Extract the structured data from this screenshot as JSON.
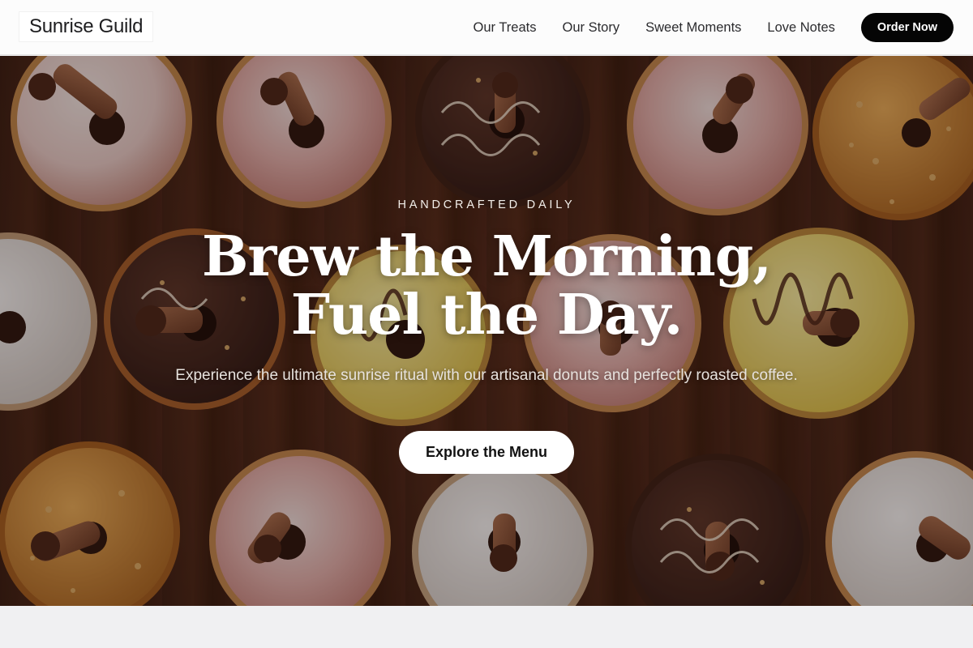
{
  "header": {
    "brand": "Sunrise Guild",
    "nav": [
      {
        "label": "Our Treats"
      },
      {
        "label": "Our Story"
      },
      {
        "label": "Sweet Moments"
      },
      {
        "label": "Love Notes"
      }
    ],
    "cta_label": "Order Now"
  },
  "hero": {
    "background_image": "donuts-on-wooden-table",
    "eyebrow": "HANDCRAFTED DAILY",
    "headline": "Brew the Morning, Fuel the Day.",
    "subtext": "Experience the ultimate sunrise ritual with our artisanal donuts and perfectly roasted coffee.",
    "cta_label": "Explore the Menu"
  },
  "colors": {
    "header_bg": "#fcfcfc",
    "brand_text": "#1d1d1f",
    "order_button_bg": "#050505",
    "hero_overlay": "#1c0e0a",
    "cta_bg": "#ffffff",
    "page_bg": "#f0f0f2"
  }
}
